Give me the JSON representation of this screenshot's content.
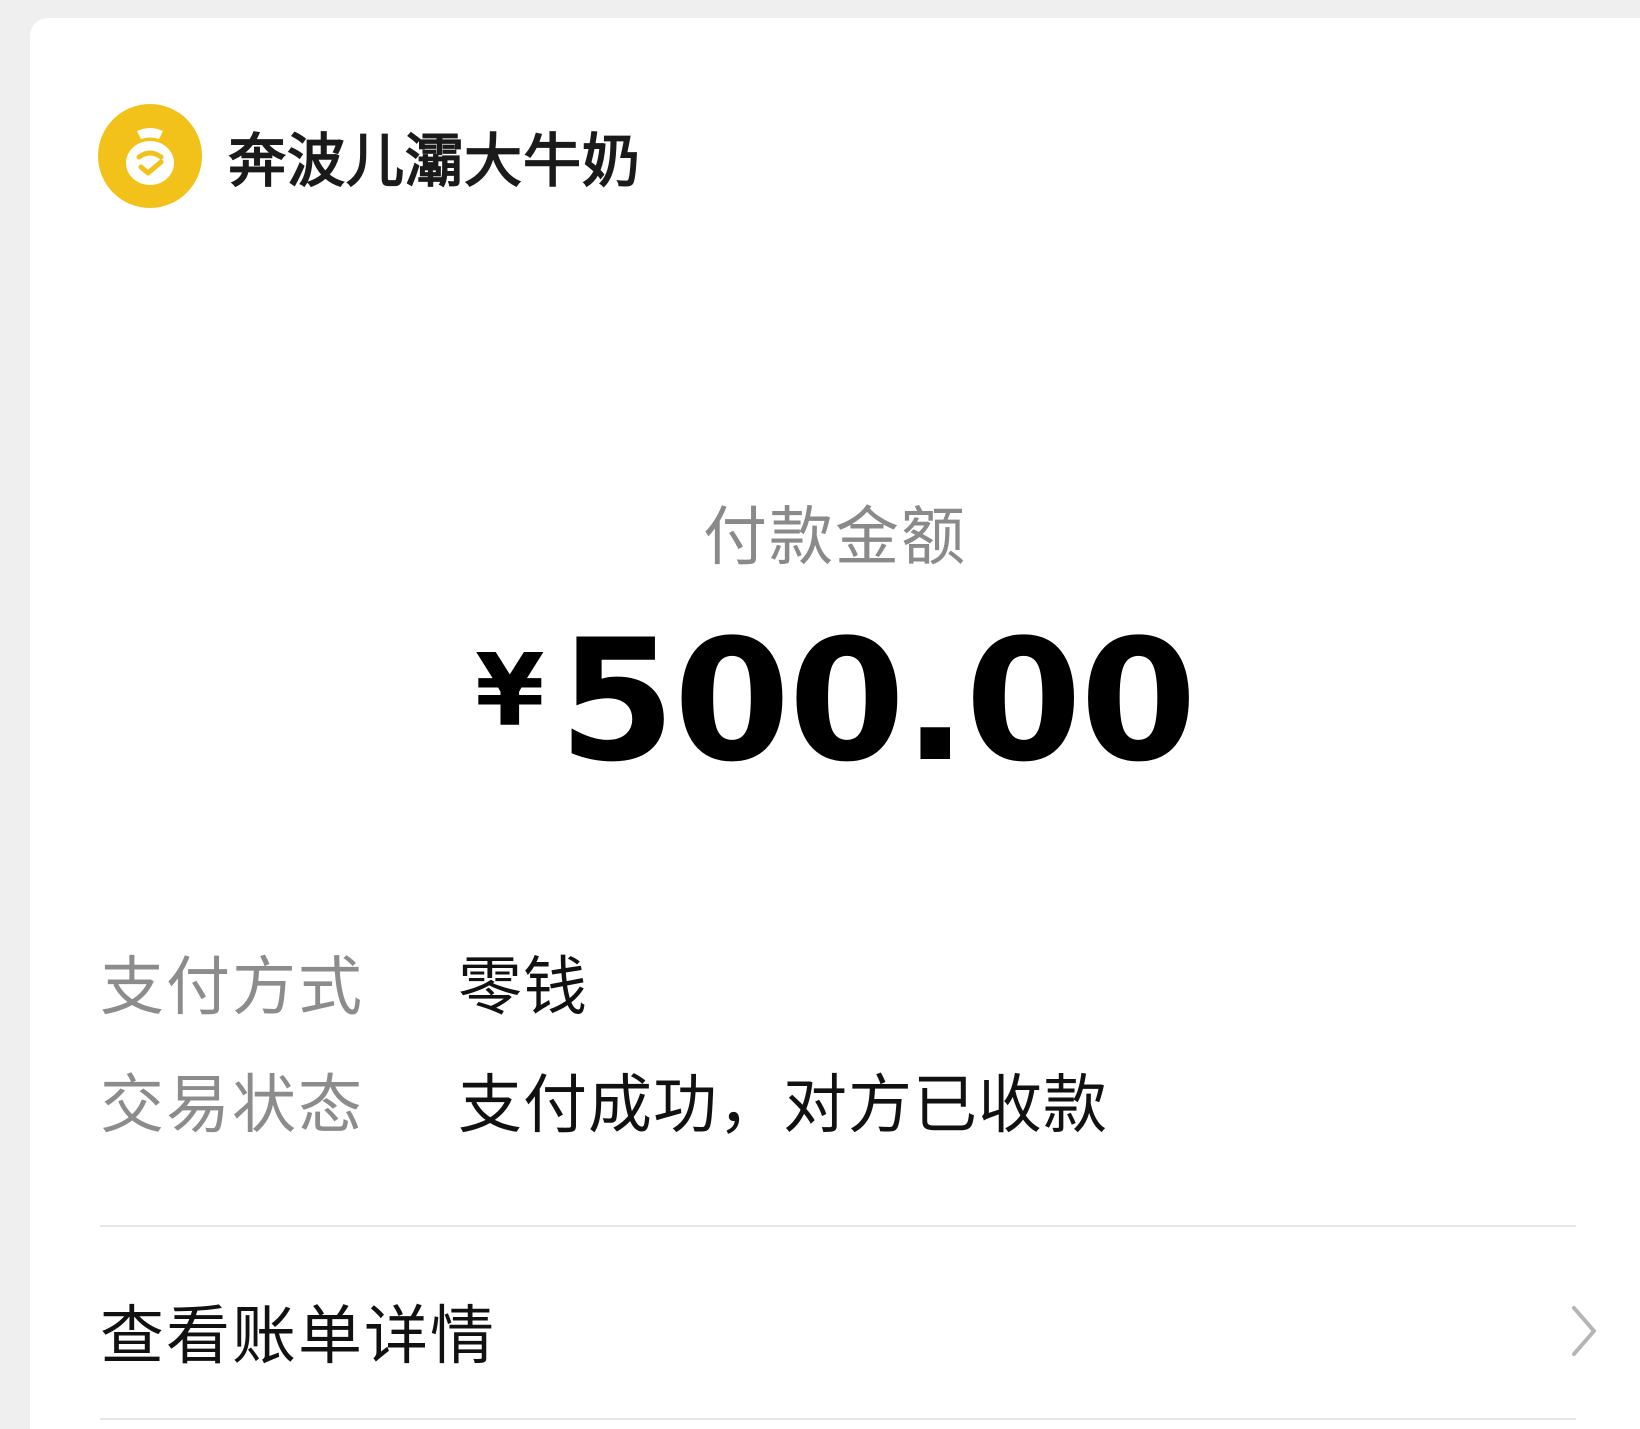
{
  "merchant": {
    "name": "奔波儿灞大牛奶",
    "logo_icon": "milk-bag-icon",
    "logo_color": "#f3c21a"
  },
  "payment": {
    "amount_label": "付款金额",
    "currency_symbol": "¥",
    "amount": "500.00"
  },
  "details": {
    "method_label": "支付方式",
    "method_value": "零钱",
    "status_label": "交易状态",
    "status_value": "支付成功，对方已收款"
  },
  "bill": {
    "label": "查看账单详情",
    "chevron_icon": "chevron-right-icon"
  }
}
